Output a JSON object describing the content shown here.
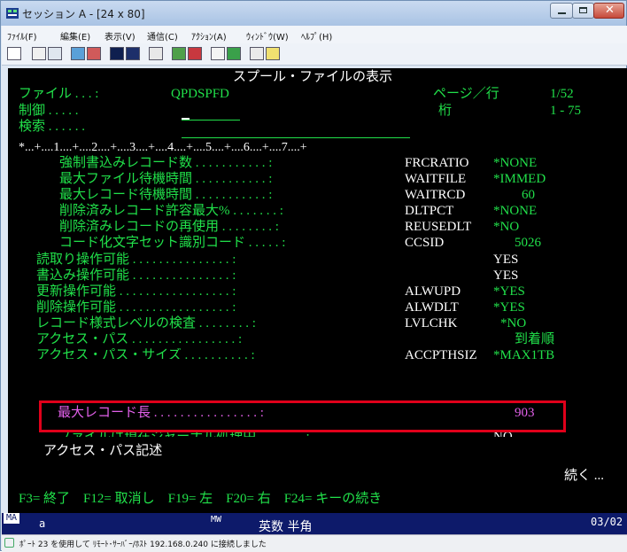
{
  "window": {
    "title": "セッション A - [24 x 80]"
  },
  "menu": {
    "items": [
      "ﾌｧｲﾙ(F)",
      "編集(E)",
      "表示(V)",
      "通信(C)",
      "ｱｸｼｮﾝ(A)",
      "ｳｨﾝﾄﾞｳ(W)",
      "ﾍﾙﾌﾟ(H)"
    ]
  },
  "screen": {
    "title": "スプール・ファイルの表示",
    "file_label": "ファイル . . . :",
    "file_value": "QPDSPFD",
    "page_label": "ページ／行",
    "page_value": "1/52",
    "control_label": "制御 . . . . .",
    "column_label": "桁",
    "column_value": "1 - 75",
    "search_label": "検索 . . . . . .",
    "ruler": "*...+....1....+....2....+....3....+....4....+....5....+....6....+....7....+",
    "rows": [
      {
        "label": "強制書込みレコード数 . . . . . . . . . . . :",
        "keyword": "FRCRATIO",
        "value": "*NONE"
      },
      {
        "label": "最大ファイル待機時間 . . . . . . . . . . . :",
        "keyword": "WAITFILE",
        "value": "*IMMED"
      },
      {
        "label": "最大レコード待機時間 . . . . . . . . . . . :",
        "keyword": "WAITRCD",
        "value": "60"
      },
      {
        "label": "削除済みレコード許容最大% . . . . . . . :",
        "keyword": "DLTPCT",
        "value": "*NONE"
      },
      {
        "label": "削除済みレコードの再使用 . . . . . . . . :",
        "keyword": "REUSEDLT",
        "value": "*NO"
      },
      {
        "label": "コード化文字セット識別コード . . . . . :",
        "keyword": "CCSID",
        "value": "5026"
      },
      {
        "label": "読取り操作可能 . . . . . . . . . . . . . . . :",
        "keyword": "",
        "value": "YES"
      },
      {
        "label": "書込み操作可能 . . . . . . . . . . . . . . . :",
        "keyword": "",
        "value": "YES"
      },
      {
        "label": "更新操作可能 . . . . . . . . . . . . . . . . . :",
        "keyword": "ALWUPD",
        "value": "*YES"
      },
      {
        "label": "削除操作可能 . . . . . . . . . . . . . . . . . :",
        "keyword": "ALWDLT",
        "value": "*YES"
      },
      {
        "label": "レコード様式レベルの検査 . . . . . . . . :",
        "keyword": "LVLCHK",
        "value": "*NO"
      },
      {
        "label": "アクセス・パス . . . . . . . . . . . . . . . . :",
        "keyword": "",
        "value": "到着順"
      },
      {
        "label": "アクセス・パス・サイズ . . . . . . . . . . :",
        "keyword": "ACCPTHSIZ",
        "value": "*MAX1TB"
      }
    ],
    "highlight_row": {
      "label": "最大レコード長 . . . . . . . . . . . . . . . . :",
      "value": "903"
    },
    "journal_row": {
      "label": "ファイルは現在ジャーナル処理中 . . . . . . . :",
      "value": "NO"
    },
    "access_path_desc": "アクセス・パス記述",
    "more": "続く ...",
    "function_keys": "F3= 終了    F12= 取消し    F19= 左    F20= 右    F24= キーの続き"
  },
  "oia": {
    "session": "MA",
    "indicator": "a",
    "mw": "MW",
    "input_mode": "英数 半角",
    "cursor_pos": "03/02"
  },
  "statusbar": {
    "text": "ﾎﾟｰﾄ 23 を使用して ﾘﾓｰﾄ･ｻｰﾊﾞｰ/ﾎｽﾄ 192.168.0.240 に接続しました"
  },
  "colors": {
    "terminal_bg": "#000000",
    "field_green": "#21e04a",
    "highlight_pink": "#e260ea",
    "annotation_red": "#e0001a",
    "oia_bg": "#0d1a6a"
  }
}
